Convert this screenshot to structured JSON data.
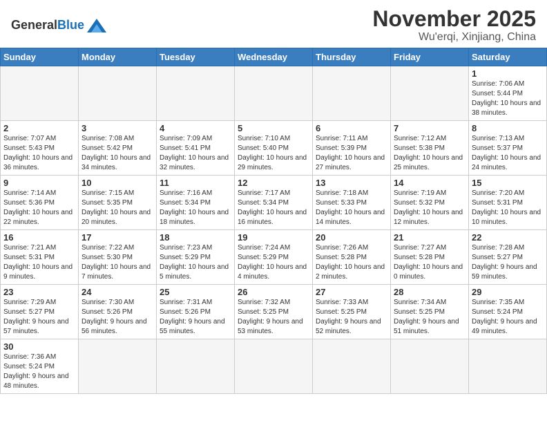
{
  "header": {
    "logo_general": "General",
    "logo_blue": "Blue",
    "month": "November 2025",
    "location": "Wu'erqi, Xinjiang, China"
  },
  "weekdays": [
    "Sunday",
    "Monday",
    "Tuesday",
    "Wednesday",
    "Thursday",
    "Friday",
    "Saturday"
  ],
  "weeks": [
    [
      {
        "day": "",
        "info": ""
      },
      {
        "day": "",
        "info": ""
      },
      {
        "day": "",
        "info": ""
      },
      {
        "day": "",
        "info": ""
      },
      {
        "day": "",
        "info": ""
      },
      {
        "day": "",
        "info": ""
      },
      {
        "day": "1",
        "info": "Sunrise: 7:06 AM\nSunset: 5:44 PM\nDaylight: 10 hours and 38 minutes."
      }
    ],
    [
      {
        "day": "2",
        "info": "Sunrise: 7:07 AM\nSunset: 5:43 PM\nDaylight: 10 hours and 36 minutes."
      },
      {
        "day": "3",
        "info": "Sunrise: 7:08 AM\nSunset: 5:42 PM\nDaylight: 10 hours and 34 minutes."
      },
      {
        "day": "4",
        "info": "Sunrise: 7:09 AM\nSunset: 5:41 PM\nDaylight: 10 hours and 32 minutes."
      },
      {
        "day": "5",
        "info": "Sunrise: 7:10 AM\nSunset: 5:40 PM\nDaylight: 10 hours and 29 minutes."
      },
      {
        "day": "6",
        "info": "Sunrise: 7:11 AM\nSunset: 5:39 PM\nDaylight: 10 hours and 27 minutes."
      },
      {
        "day": "7",
        "info": "Sunrise: 7:12 AM\nSunset: 5:38 PM\nDaylight: 10 hours and 25 minutes."
      },
      {
        "day": "8",
        "info": "Sunrise: 7:13 AM\nSunset: 5:37 PM\nDaylight: 10 hours and 24 minutes."
      }
    ],
    [
      {
        "day": "9",
        "info": "Sunrise: 7:14 AM\nSunset: 5:36 PM\nDaylight: 10 hours and 22 minutes."
      },
      {
        "day": "10",
        "info": "Sunrise: 7:15 AM\nSunset: 5:35 PM\nDaylight: 10 hours and 20 minutes."
      },
      {
        "day": "11",
        "info": "Sunrise: 7:16 AM\nSunset: 5:34 PM\nDaylight: 10 hours and 18 minutes."
      },
      {
        "day": "12",
        "info": "Sunrise: 7:17 AM\nSunset: 5:34 PM\nDaylight: 10 hours and 16 minutes."
      },
      {
        "day": "13",
        "info": "Sunrise: 7:18 AM\nSunset: 5:33 PM\nDaylight: 10 hours and 14 minutes."
      },
      {
        "day": "14",
        "info": "Sunrise: 7:19 AM\nSunset: 5:32 PM\nDaylight: 10 hours and 12 minutes."
      },
      {
        "day": "15",
        "info": "Sunrise: 7:20 AM\nSunset: 5:31 PM\nDaylight: 10 hours and 10 minutes."
      }
    ],
    [
      {
        "day": "16",
        "info": "Sunrise: 7:21 AM\nSunset: 5:31 PM\nDaylight: 10 hours and 9 minutes."
      },
      {
        "day": "17",
        "info": "Sunrise: 7:22 AM\nSunset: 5:30 PM\nDaylight: 10 hours and 7 minutes."
      },
      {
        "day": "18",
        "info": "Sunrise: 7:23 AM\nSunset: 5:29 PM\nDaylight: 10 hours and 5 minutes."
      },
      {
        "day": "19",
        "info": "Sunrise: 7:24 AM\nSunset: 5:29 PM\nDaylight: 10 hours and 4 minutes."
      },
      {
        "day": "20",
        "info": "Sunrise: 7:26 AM\nSunset: 5:28 PM\nDaylight: 10 hours and 2 minutes."
      },
      {
        "day": "21",
        "info": "Sunrise: 7:27 AM\nSunset: 5:28 PM\nDaylight: 10 hours and 0 minutes."
      },
      {
        "day": "22",
        "info": "Sunrise: 7:28 AM\nSunset: 5:27 PM\nDaylight: 9 hours and 59 minutes."
      }
    ],
    [
      {
        "day": "23",
        "info": "Sunrise: 7:29 AM\nSunset: 5:27 PM\nDaylight: 9 hours and 57 minutes."
      },
      {
        "day": "24",
        "info": "Sunrise: 7:30 AM\nSunset: 5:26 PM\nDaylight: 9 hours and 56 minutes."
      },
      {
        "day": "25",
        "info": "Sunrise: 7:31 AM\nSunset: 5:26 PM\nDaylight: 9 hours and 55 minutes."
      },
      {
        "day": "26",
        "info": "Sunrise: 7:32 AM\nSunset: 5:25 PM\nDaylight: 9 hours and 53 minutes."
      },
      {
        "day": "27",
        "info": "Sunrise: 7:33 AM\nSunset: 5:25 PM\nDaylight: 9 hours and 52 minutes."
      },
      {
        "day": "28",
        "info": "Sunrise: 7:34 AM\nSunset: 5:25 PM\nDaylight: 9 hours and 51 minutes."
      },
      {
        "day": "29",
        "info": "Sunrise: 7:35 AM\nSunset: 5:24 PM\nDaylight: 9 hours and 49 minutes."
      }
    ],
    [
      {
        "day": "30",
        "info": "Sunrise: 7:36 AM\nSunset: 5:24 PM\nDaylight: 9 hours and 48 minutes."
      },
      {
        "day": "",
        "info": ""
      },
      {
        "day": "",
        "info": ""
      },
      {
        "day": "",
        "info": ""
      },
      {
        "day": "",
        "info": ""
      },
      {
        "day": "",
        "info": ""
      },
      {
        "day": "",
        "info": ""
      }
    ]
  ]
}
